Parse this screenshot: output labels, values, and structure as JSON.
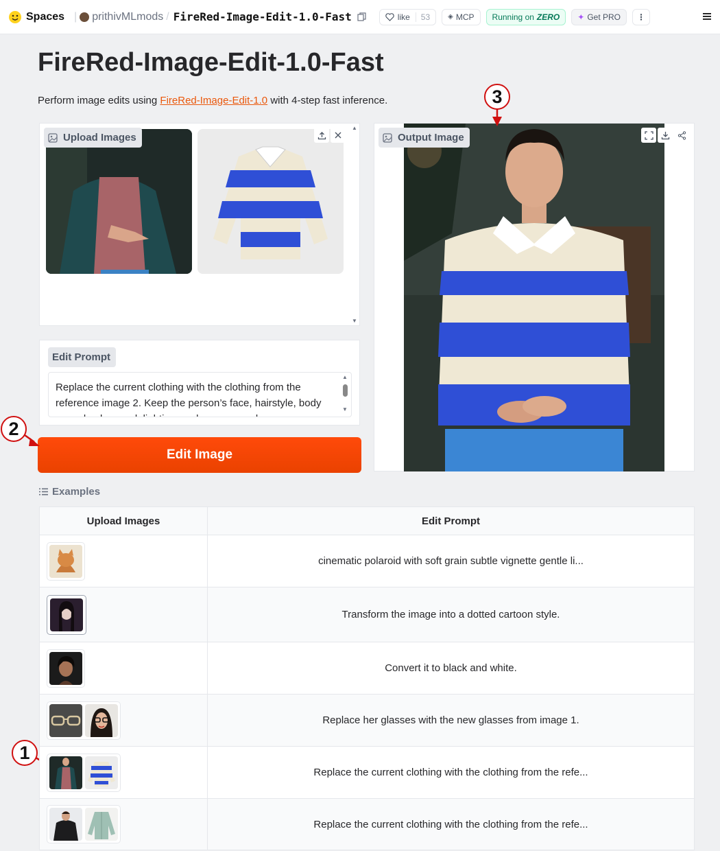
{
  "topbar": {
    "brand": "Spaces",
    "owner": "prithivMLmods",
    "separator": "/",
    "space_name": "FireRed-Image-Edit-1.0-Fast",
    "like_label": "like",
    "like_count": "53",
    "mcp_label": "MCP",
    "running_label": "Running on",
    "running_hardware": "ZERO",
    "pro_label": "Get PRO"
  },
  "page": {
    "title": "FireRed-Image-Edit-1.0-Fast",
    "desc_prefix": "Perform image edits using ",
    "desc_link": "FireRed-Image-Edit-1.0",
    "desc_suffix": " with 4-step fast inference."
  },
  "upload": {
    "label": "Upload Images"
  },
  "output": {
    "label": "Output Image"
  },
  "prompt": {
    "label": "Edit Prompt",
    "value": "Replace the current clothing with the clothing from the reference image 2. Keep the person’s face, hairstyle, body pose, background, lighting, and camera angle"
  },
  "edit_button": {
    "label": "Edit Image"
  },
  "markers": {
    "m1": "1",
    "m2": "2",
    "m3": "3"
  },
  "examples": {
    "label": "Examples",
    "col_images": "Upload Images",
    "col_prompt": "Edit Prompt",
    "rows": [
      {
        "prompt": "cinematic polaroid with soft grain subtle vignette gentle li..."
      },
      {
        "prompt": "Transform the image into a dotted cartoon style."
      },
      {
        "prompt": "Convert it to black and white."
      },
      {
        "prompt": "Replace her glasses with the new glasses from image 1."
      },
      {
        "prompt": "Replace the current clothing with the clothing from the refe..."
      },
      {
        "prompt": "Replace the current clothing with the clothing from the refe..."
      }
    ]
  },
  "colors": {
    "accent": "#ea580c",
    "button": "#f44a0a",
    "marker": "#d01010",
    "shirt_blue": "#2f4fd6",
    "shirt_cream": "#efe8d4"
  }
}
